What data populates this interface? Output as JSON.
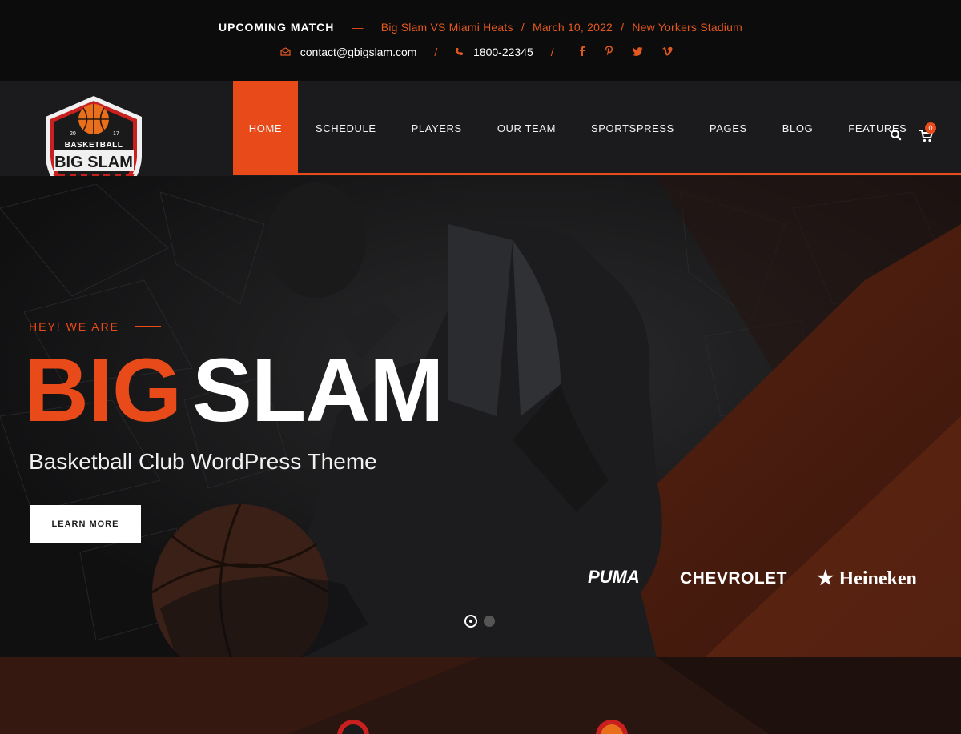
{
  "topbar": {
    "match_title": "UPCOMING MATCH",
    "match_dash": "—",
    "match_teams": "Big Slam VS Miami Heats",
    "match_date": "March 10, 2022",
    "match_venue": "New Yorkers Stadium",
    "match_sep": "/",
    "email": "contact@gbigslam.com",
    "phone": "1800-22345",
    "contact_sep": "/",
    "social": [
      "f",
      "p",
      "t",
      "v"
    ]
  },
  "logo": {
    "line1": "BASKETBALL",
    "line2": "BIG SLAM",
    "year_left": "20",
    "year_right": "17"
  },
  "nav": {
    "items": [
      "HOME",
      "SCHEDULE",
      "PLAYERS",
      "OUR TEAM",
      "SPORTSPRESS",
      "PAGES",
      "BLOG",
      "FEATURES"
    ],
    "cart_count": "0"
  },
  "hero": {
    "eyebrow": "HEY! WE ARE",
    "title_1": "BIG",
    "title_2": "SLAM",
    "subtitle": "Basketball Club WordPress Theme",
    "button": "LEARN MORE",
    "sponsors": [
      "PUMA",
      "CHEVROLET",
      "★ Heineken"
    ]
  },
  "colors": {
    "accent": "#e84a1a",
    "header_bg": "#1b1b1d",
    "topbar_bg": "#0d0c0d"
  }
}
